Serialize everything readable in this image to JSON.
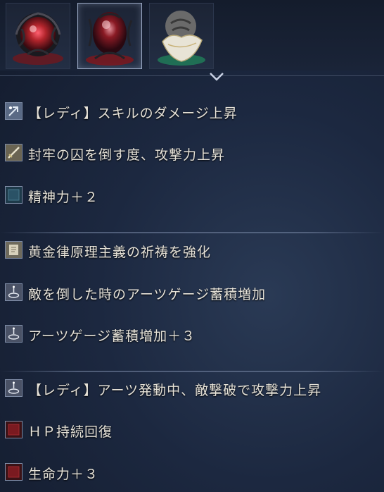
{
  "relic_slots": [
    {
      "name": "crimson-relic",
      "selected": false,
      "color": "#b0242b"
    },
    {
      "name": "crimson-relic",
      "selected": true,
      "color": "#b0242b"
    },
    {
      "name": "white-relic",
      "selected": false,
      "color": "#d6d2c4"
    }
  ],
  "groups": [
    {
      "effects": [
        {
          "icon": "skill-icon",
          "text": "【レディ】スキルのダメージ上昇"
        },
        {
          "icon": "sword-icon",
          "text": "封牢の囚を倒す度、攻撃力上昇"
        },
        {
          "icon": "mind-icon",
          "text": "精神力＋２"
        }
      ]
    },
    {
      "effects": [
        {
          "icon": "incantation-icon",
          "text": "黄金律原理主義の祈祷を強化"
        },
        {
          "icon": "arts-icon",
          "text": "敵を倒した時のアーツゲージ蓄積増加"
        },
        {
          "icon": "arts-icon",
          "text": "アーツゲージ蓄積増加＋３"
        }
      ]
    },
    {
      "effects": [
        {
          "icon": "arts-icon",
          "text": "【レディ】アーツ発動中、敵撃破で攻撃力上昇"
        },
        {
          "icon": "hp-icon",
          "text": "ＨＰ持続回復"
        },
        {
          "icon": "vigor-icon",
          "text": "生命力＋３"
        }
      ]
    }
  ],
  "colors": {
    "text": "#e6e2d8",
    "divider": "#3f4b63",
    "accent_red": "#b0242b"
  }
}
